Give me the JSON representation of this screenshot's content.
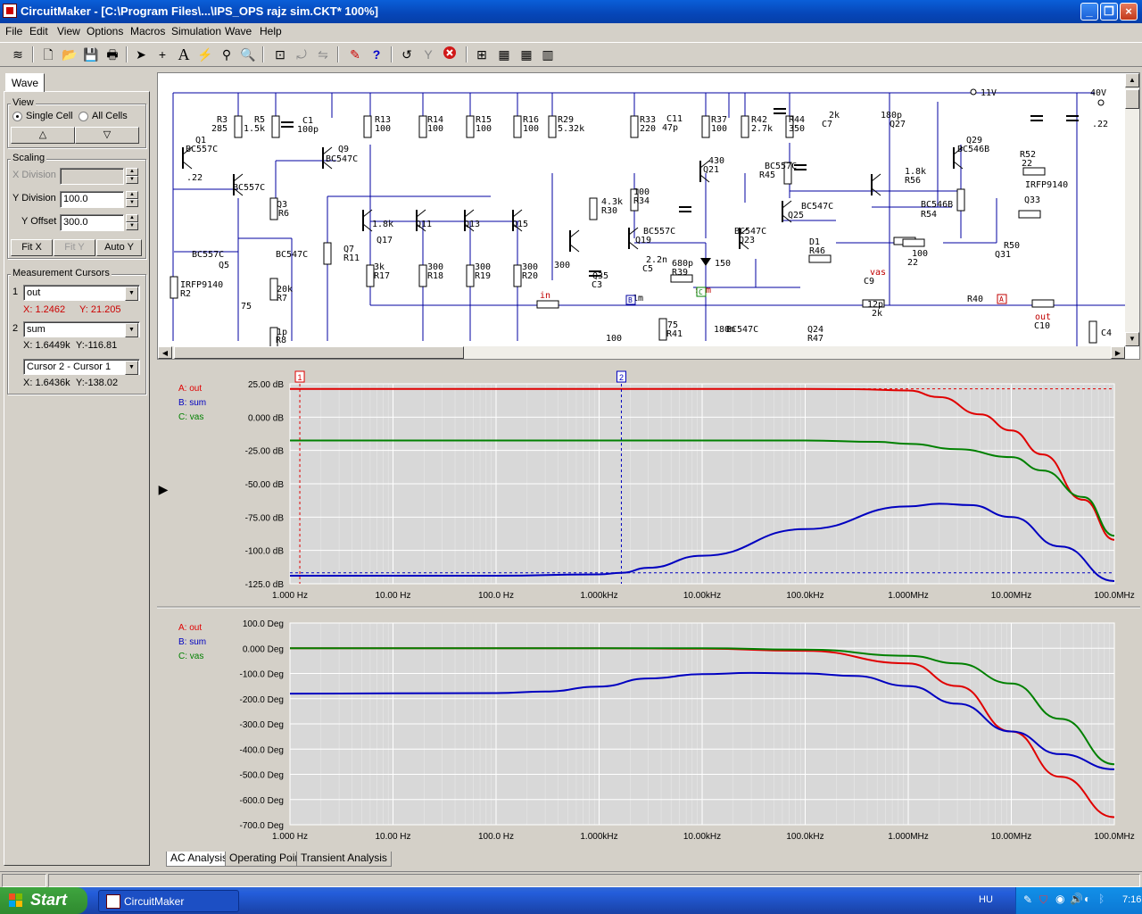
{
  "window": {
    "title": "CircuitMaker - [C:\\Program Files\\...\\IPS_OPS rajz sim.CKT* 100%]"
  },
  "menu": [
    "File",
    "Edit",
    "View",
    "Options",
    "Macros",
    "Simulation",
    "Wave",
    "Help"
  ],
  "toolbar_icons": [
    "wave-icon",
    "new-file-icon",
    "open-folder-icon",
    "save-icon",
    "print-icon",
    "arrow-tool-icon",
    "wire-tool-icon",
    "text-tool-icon",
    "probe-tool-icon",
    "search-tool-icon",
    "zoom-icon",
    "fit-icon",
    "rotate-icon",
    "mirror-icon",
    "digital-sim-icon",
    "help-icon",
    "reset-icon",
    "step-icon",
    "stop-icon",
    "run-icon",
    "scope-icon",
    "analog-icon",
    "digital-icon"
  ],
  "left_panel": {
    "tab": "Wave",
    "view": {
      "label": "View",
      "single": "Single Cell",
      "all": "All Cells"
    },
    "scaling": {
      "label": "Scaling",
      "xdiv_label": "X Division",
      "xdiv_value": "",
      "ydiv_label": "Y Division",
      "ydiv_value": "100.0",
      "yoff_label": "Y Offset",
      "yoff_value": "300.0",
      "fitx": "Fit X",
      "fity": "Fit Y",
      "autoy": "Auto Y"
    },
    "cursors": {
      "label": "Measurement Cursors",
      "c1": {
        "num": "1",
        "signal": "out",
        "x": "X: 1.2462",
        "y": "Y: 21.205"
      },
      "c2": {
        "num": "2",
        "signal": "sum",
        "x": "X: 1.6449k",
        "y": "Y:-116.81"
      },
      "diff": {
        "signal": "Cursor 2 - Cursor 1",
        "x": "X: 1.6436k",
        "y": "Y:-138.02"
      }
    }
  },
  "schematic": {
    "rails": [
      "11V",
      "40V"
    ],
    "labels": [
      "R3",
      "285",
      "R5",
      "1.5k",
      "C1",
      "100p",
      "Q1",
      "BC557C",
      "Q9",
      "BC547C",
      "R13",
      "100",
      "R14",
      "100",
      "R15",
      "100",
      "R16",
      "100",
      "R29",
      "5.32k",
      "R33",
      "220",
      "C11",
      "47p",
      "R37",
      "100",
      "R42",
      "2.7k",
      "R44",
      "350",
      "Q29",
      "BC546B",
      "R52",
      "22",
      "Q33",
      "IRFP9140",
      ".22",
      ".22",
      "BC557C",
      "Q3",
      "R6",
      "4.3k",
      "R30",
      "100",
      "R34",
      "430",
      "Q21",
      "BC557C",
      "R45",
      "2k",
      "C7",
      "180p",
      "Q27",
      "BC546B",
      "R54",
      "1.8k",
      "R56",
      "1.8k",
      "Q11",
      "Q13",
      "Q15",
      "Q17",
      "BC557C",
      "Q19",
      "BC547C",
      "Q25",
      "BC547C",
      "Q23",
      "BC557C",
      "Q5",
      "BC547C",
      "Q7",
      "R11",
      "3k",
      "R17",
      "300",
      "R18",
      "300",
      "R19",
      "300",
      "R20",
      "300",
      "Q35",
      "C3",
      "2.2n",
      "C5",
      "680p",
      "R39",
      "150",
      "D1",
      "R46",
      "100",
      "22",
      "R50",
      "Q31",
      "IRFP9140",
      "R2",
      "20k",
      "R7",
      "75",
      "in",
      "1m",
      "sum",
      "vas",
      "C9",
      "12p",
      "2k",
      "R40",
      "out",
      "C10",
      "1p",
      "R8",
      "75",
      "R41",
      "180m",
      "BC547C",
      "Q24",
      "R47",
      "100",
      "C4",
      "4"
    ],
    "markers": {
      "sum": "B",
      "vas": "C",
      "out": "A"
    }
  },
  "chart_data": [
    {
      "type": "line",
      "title": "",
      "x_scale": "log",
      "x_ticks": [
        "1.000 Hz",
        "10.00 Hz",
        "100.0 Hz",
        "1.000kHz",
        "10.00kHz",
        "100.0kHz",
        "1.000MHz",
        "10.00MHz",
        "100.0MHz"
      ],
      "y_ticks": [
        "25.00 dB",
        "0.000 dB",
        "-25.00 dB",
        "-50.00 dB",
        "-75.00 dB",
        "-100.0 dB",
        "-125.0 dB"
      ],
      "ylim": [
        -125,
        25
      ],
      "xlim": [
        1,
        100000000
      ],
      "grid": true,
      "legend": [
        "A: out",
        "B: sum",
        "C: vas"
      ],
      "series": [
        {
          "name": "A: out",
          "color": "#e00000",
          "x": [
            1,
            100000,
            300000,
            1000000,
            2000000,
            5000000,
            10000000,
            20000000,
            50000000,
            100000000
          ],
          "values": [
            21.2,
            21.2,
            21.0,
            20,
            15,
            2,
            -10,
            -28,
            -62,
            -92
          ]
        },
        {
          "name": "B: sum",
          "color": "#0000c0",
          "x": [
            1,
            100,
            1000,
            1645,
            3000,
            10000,
            100000,
            1000000,
            2000000,
            4000000,
            10000000,
            30000000,
            100000000
          ],
          "values": [
            -119,
            -119,
            -118,
            -116.8,
            -113,
            -104,
            -84,
            -67,
            -65,
            -66,
            -75,
            -97,
            -123
          ]
        },
        {
          "name": "C: vas",
          "color": "#008000",
          "x": [
            1,
            100000,
            500000,
            1000000,
            3000000,
            10000000,
            20000000,
            50000000,
            100000000
          ],
          "values": [
            -17.5,
            -17.5,
            -18.5,
            -20,
            -24,
            -30,
            -40,
            -60,
            -89
          ]
        }
      ],
      "cursors": [
        {
          "label": "1",
          "x": 1.2462,
          "color": "#e00000"
        },
        {
          "label": "2",
          "x": 1644.9,
          "color": "#0000c0"
        }
      ],
      "cursor_levels": [
        {
          "y": 21.205,
          "color": "#e00000"
        },
        {
          "y": -116.81,
          "color": "#0000c0"
        }
      ]
    },
    {
      "type": "line",
      "title": "",
      "x_scale": "log",
      "x_ticks": [
        "1.000 Hz",
        "10.00 Hz",
        "100.0 Hz",
        "1.000kHz",
        "10.00kHz",
        "100.0kHz",
        "1.000MHz",
        "10.00MHz",
        "100.0MHz"
      ],
      "y_ticks": [
        "100.0 Deg",
        "0.000 Deg",
        "-100.0 Deg",
        "-200.0 Deg",
        "-300.0 Deg",
        "-400.0 Deg",
        "-500.0 Deg",
        "-600.0 Deg",
        "-700.0 Deg"
      ],
      "ylim": [
        -700,
        100
      ],
      "xlim": [
        1,
        100000000
      ],
      "grid": true,
      "legend": [
        "A: out",
        "B: sum",
        "C: vas"
      ],
      "series": [
        {
          "name": "A: out",
          "color": "#e00000",
          "x": [
            1,
            1000,
            10000,
            100000,
            1000000,
            3000000,
            10000000,
            30000000,
            100000000
          ],
          "values": [
            0,
            0,
            -2,
            -10,
            -60,
            -150,
            -330,
            -510,
            -670
          ]
        },
        {
          "name": "B: sum",
          "color": "#0000c0",
          "x": [
            1,
            100,
            300,
            1000,
            3000,
            10000,
            30000,
            100000,
            300000,
            1000000,
            3000000,
            10000000,
            30000000,
            100000000
          ],
          "values": [
            -180,
            -178,
            -172,
            -152,
            -120,
            -103,
            -98,
            -100,
            -110,
            -150,
            -220,
            -330,
            -420,
            -480
          ]
        },
        {
          "name": "C: vas",
          "color": "#008000",
          "x": [
            1,
            10000,
            100000,
            1000000,
            3000000,
            10000000,
            30000000,
            100000000
          ],
          "values": [
            0,
            0,
            -5,
            -30,
            -60,
            -140,
            -280,
            -460
          ]
        }
      ]
    }
  ],
  "bottom_tabs": [
    "AC Analysis",
    "Operating Point",
    "Transient Analysis"
  ],
  "taskbar": {
    "start": "Start",
    "task": "CircuitMaker",
    "lang": "HU",
    "clock": "7:16"
  }
}
